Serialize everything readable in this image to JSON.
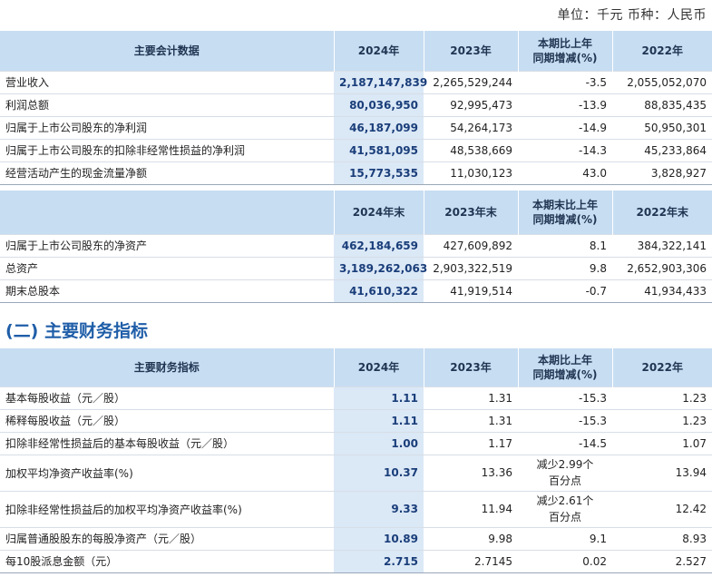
{
  "unit_line": "单位：千元   币种：人民币",
  "section_title": "(二) 主要财务指标",
  "table1": {
    "headers": [
      "主要会计数据",
      "2024年",
      "2023年",
      "本期比上年\n同期增减(%)",
      "2022年"
    ],
    "rows": [
      [
        "营业收入",
        "2,187,147,839",
        "2,265,529,244",
        "-3.5",
        "2,055,052,070"
      ],
      [
        "利润总额",
        "80,036,950",
        "92,995,473",
        "-13.9",
        "88,835,435"
      ],
      [
        "归属于上市公司股东的净利润",
        "46,187,099",
        "54,264,173",
        "-14.9",
        "50,950,301"
      ],
      [
        "归属于上市公司股东的扣除非经常性损益的净利润",
        "41,581,095",
        "48,538,669",
        "-14.3",
        "45,233,864"
      ],
      [
        "经营活动产生的现金流量净额",
        "15,773,535",
        "11,030,123",
        "43.0",
        "3,828,927"
      ]
    ]
  },
  "table2": {
    "headers": [
      "",
      "2024年末",
      "2023年末",
      "本期末比上年\n同期增减(%)",
      "2022年末"
    ],
    "rows": [
      [
        "归属于上市公司股东的净资产",
        "462,184,659",
        "427,609,892",
        "8.1",
        "384,322,141"
      ],
      [
        "总资产",
        "3,189,262,063",
        "2,903,322,519",
        "9.8",
        "2,652,903,306"
      ],
      [
        "期末总股本",
        "41,610,322",
        "41,919,514",
        "-0.7",
        "41,934,433"
      ]
    ]
  },
  "table3": {
    "headers": [
      "主要财务指标",
      "2024年",
      "2023年",
      "本期比上年\n同期增减(%)",
      "2022年"
    ],
    "rows": [
      [
        "基本每股收益（元／股）",
        "1.11",
        "1.31",
        "-15.3",
        "1.23"
      ],
      [
        "稀释每股收益（元／股）",
        "1.11",
        "1.31",
        "-15.3",
        "1.23"
      ],
      [
        "扣除非经常性损益后的基本每股收益（元／股）",
        "1.00",
        "1.17",
        "-14.5",
        "1.07"
      ],
      [
        "加权平均净资产收益率(%)",
        "10.37",
        "13.36",
        "减少2.99个\n百分点",
        "13.94"
      ],
      [
        "扣除非经常性损益后的加权平均净资产收益率(%)",
        "9.33",
        "11.94",
        "减少2.61个\n百分点",
        "12.42"
      ],
      [
        "归属普通股股东的每股净资产（元／股）",
        "10.89",
        "9.98",
        "9.1",
        "8.93"
      ],
      [
        "每10股派息金额（元）",
        "2.715",
        "2.7145",
        "0.02",
        "2.527"
      ]
    ]
  },
  "colors": {
    "header_bg": "#c7ddf2",
    "highlight_bg": "#dbe8f6",
    "section_title": "#1f5ea8"
  }
}
